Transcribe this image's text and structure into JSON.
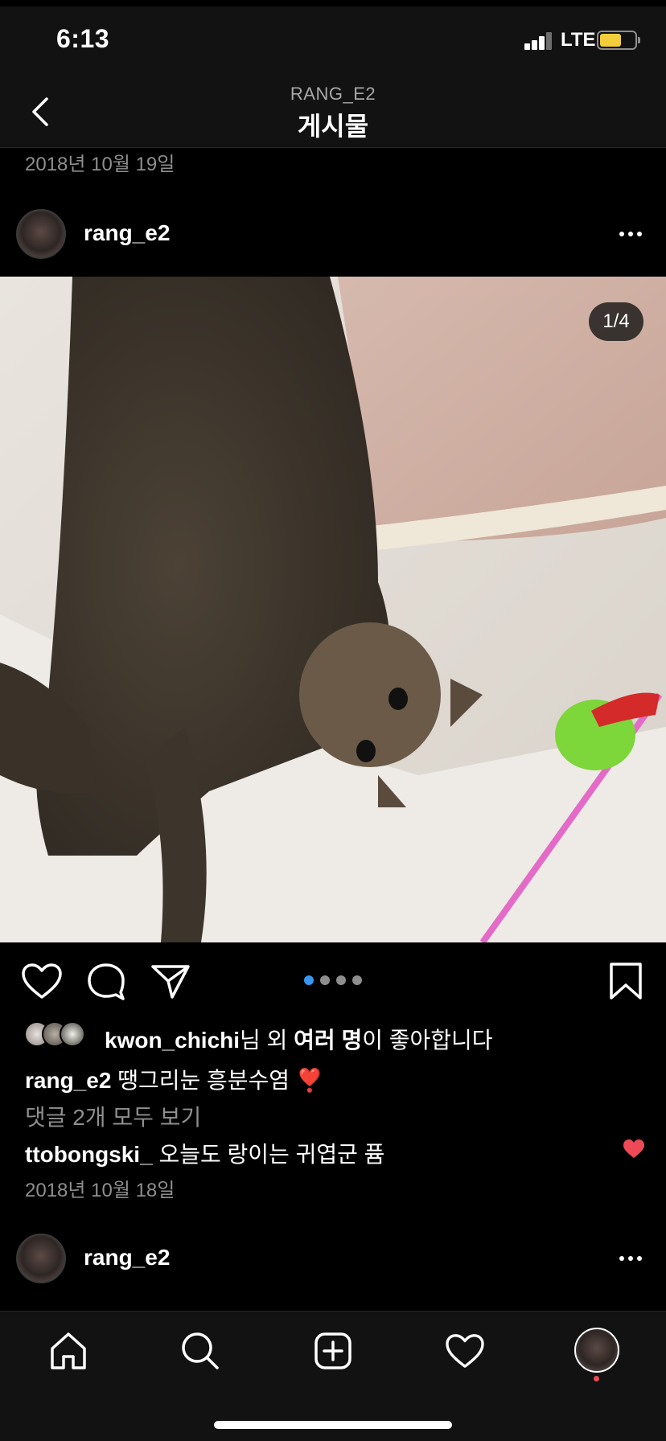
{
  "status_bar": {
    "time": "6:13",
    "network": "LTE"
  },
  "header": {
    "subtitle": "RANG_E2",
    "title": "게시물",
    "back_icon": "chevron-left-icon"
  },
  "previous_post": {
    "date": "2018년 10월 19일"
  },
  "post": {
    "username": "rang_e2",
    "image_counter": "1/4",
    "carousel": {
      "count": 4,
      "active_index": 0
    },
    "likes": {
      "user": "kwon_chichi",
      "suffix_1": "님 외 ",
      "others": "여러 명",
      "suffix_2": "이 좋아합니다"
    },
    "caption": {
      "username": "rang_e2",
      "text": " 땡그리눈 흥분수염 ❣️"
    },
    "view_all_comments": "댓글 2개 모두 보기",
    "comment": {
      "username": "ttobongski_",
      "text": " 오늘도 랑이는 귀엽군 퓸"
    },
    "date": "2018년 10월 18일"
  },
  "next_post": {
    "username": "rang_e2"
  },
  "colors": {
    "accent": "#3897f0",
    "like_red": "#ed4956",
    "background": "#000000",
    "bar": "#121212",
    "muted": "#8e8e8e"
  },
  "tabs": [
    "home-icon",
    "search-icon",
    "new-post-icon",
    "activity-heart-icon",
    "profile-avatar"
  ]
}
